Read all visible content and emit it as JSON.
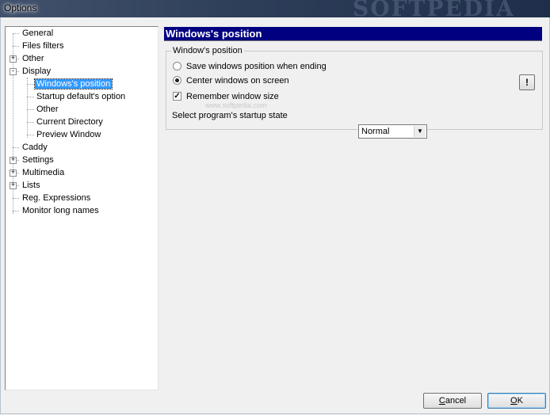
{
  "window": {
    "title": "Options",
    "watermark": "SOFTPEDIA"
  },
  "tree": {
    "items": [
      {
        "label": "General"
      },
      {
        "label": "Files filters"
      },
      {
        "label": "Other",
        "expander": "+"
      },
      {
        "label": "Display",
        "expander": "-"
      },
      {
        "label": "Windows's position",
        "selected": true
      },
      {
        "label": "Startup default's option"
      },
      {
        "label": "Other"
      },
      {
        "label": "Current Directory"
      },
      {
        "label": "Preview Window"
      },
      {
        "label": "Caddy"
      },
      {
        "label": "Settings",
        "expander": "+"
      },
      {
        "label": "Multimedia",
        "expander": "+"
      },
      {
        "label": "Lists",
        "expander": "+"
      },
      {
        "label": "Reg. Expressions"
      },
      {
        "label": "Monitor long names"
      }
    ]
  },
  "panel": {
    "header": "Windows's position",
    "group_label": "Window's position",
    "options": {
      "save_position": {
        "label": "Save windows position when ending",
        "checked": false
      },
      "center_windows": {
        "label": "Center windows on screen",
        "checked": true
      },
      "remember_size": {
        "label": "Remember window size",
        "checked": true
      }
    },
    "info_button": "!",
    "startup_state_label": "Select program's startup state",
    "startup_state_value": "Normal",
    "faint_watermark": "www.softpedia.com"
  },
  "buttons": {
    "cancel_hotkey": "C",
    "cancel_rest": "ancel",
    "ok_hotkey": "O",
    "ok_rest": "K"
  }
}
